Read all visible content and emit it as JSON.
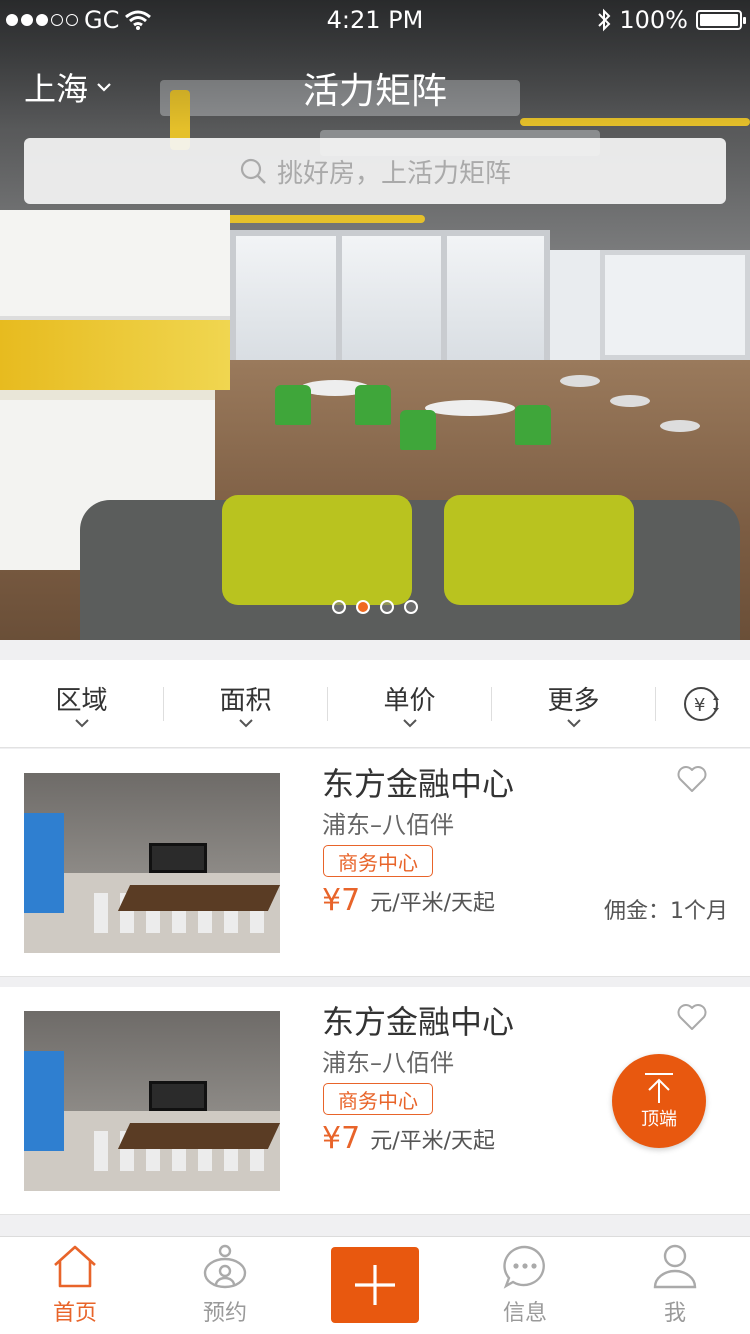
{
  "status_bar": {
    "carrier": "GC",
    "time": "4:21 PM",
    "battery": "100%"
  },
  "header": {
    "city": "上海",
    "title": "活力矩阵",
    "search_placeholder": "挑好房，上活力矩阵"
  },
  "banner": {
    "page_count": 4,
    "active_index": 1
  },
  "filters": [
    {
      "label": "区域"
    },
    {
      "label": "面积"
    },
    {
      "label": "单价"
    },
    {
      "label": "更多"
    }
  ],
  "listings": [
    {
      "title": "东方金融中心",
      "location": "浦东–八佰伴",
      "tag": "商务中心",
      "price": "¥7",
      "unit": "元/平米/天起",
      "commission": "佣金：1个月"
    },
    {
      "title": "东方金融中心",
      "location": "浦东–八佰伴",
      "tag": "商务中心",
      "price": "¥7",
      "unit": "元/平米/天起",
      "commission": ""
    }
  ],
  "back_to_top": {
    "label": "顶端"
  },
  "tabbar": {
    "home": "首页",
    "booking": "预约",
    "messages": "信息",
    "me": "我"
  },
  "colors": {
    "accent": "#e8642a",
    "accent_dark": "#e8580f"
  }
}
